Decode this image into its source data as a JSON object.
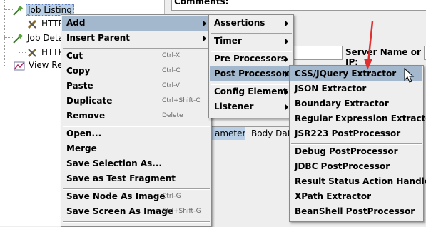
{
  "tree": {
    "items": [
      {
        "label": "Job Listing",
        "icon": "test-fragment-icon"
      },
      {
        "label": "HTTP",
        "icon": "http-sampler-icon"
      },
      {
        "label": "Job Details",
        "icon": "test-fragment-icon"
      },
      {
        "label": "HTTP",
        "icon": "http-sampler-icon"
      },
      {
        "label": "View Re",
        "icon": "listener-graph-icon"
      }
    ]
  },
  "panel": {
    "comments_label": "Comments:",
    "server_label": "Server Name or IP:",
    "tab_parameters": "ameters",
    "tab_body_data": "Body Data"
  },
  "context_menu": {
    "add": "Add",
    "insert_parent": "Insert Parent",
    "cut": "Cut",
    "cut_sc": "Ctrl-X",
    "copy": "Copy",
    "copy_sc": "Ctrl-C",
    "paste": "Paste",
    "paste_sc": "Ctrl-V",
    "duplicate": "Duplicate",
    "duplicate_sc": "Ctrl+Shift-C",
    "remove": "Remove",
    "remove_sc": "Delete",
    "open": "Open...",
    "merge": "Merge",
    "save_selection": "Save Selection As...",
    "save_fragment": "Save as Test Fragment",
    "save_node_image": "Save Node As Image",
    "save_node_image_sc": "Ctrl-G",
    "save_screen_image": "Save Screen As Image",
    "save_screen_image_sc": "Ctrl+Shift-G"
  },
  "add_menu": {
    "assertions": "Assertions",
    "timer": "Timer",
    "pre_processors": "Pre Processors",
    "post_processors": "Post Processors",
    "config_element": "Config Element",
    "listener": "Listener"
  },
  "post_menu": {
    "items": [
      "CSS/JQuery Extractor",
      "JSON Extractor",
      "Boundary Extractor",
      "Regular Expression Extractor",
      "JSR223 PostProcessor",
      "Debug PostProcessor",
      "JDBC PostProcessor",
      "Result Status Action Handler",
      "XPath Extractor",
      "BeanShell PostProcessor"
    ]
  },
  "colors": {
    "highlight": "#a3b8cc",
    "annotation_arrow": "#e03030"
  }
}
